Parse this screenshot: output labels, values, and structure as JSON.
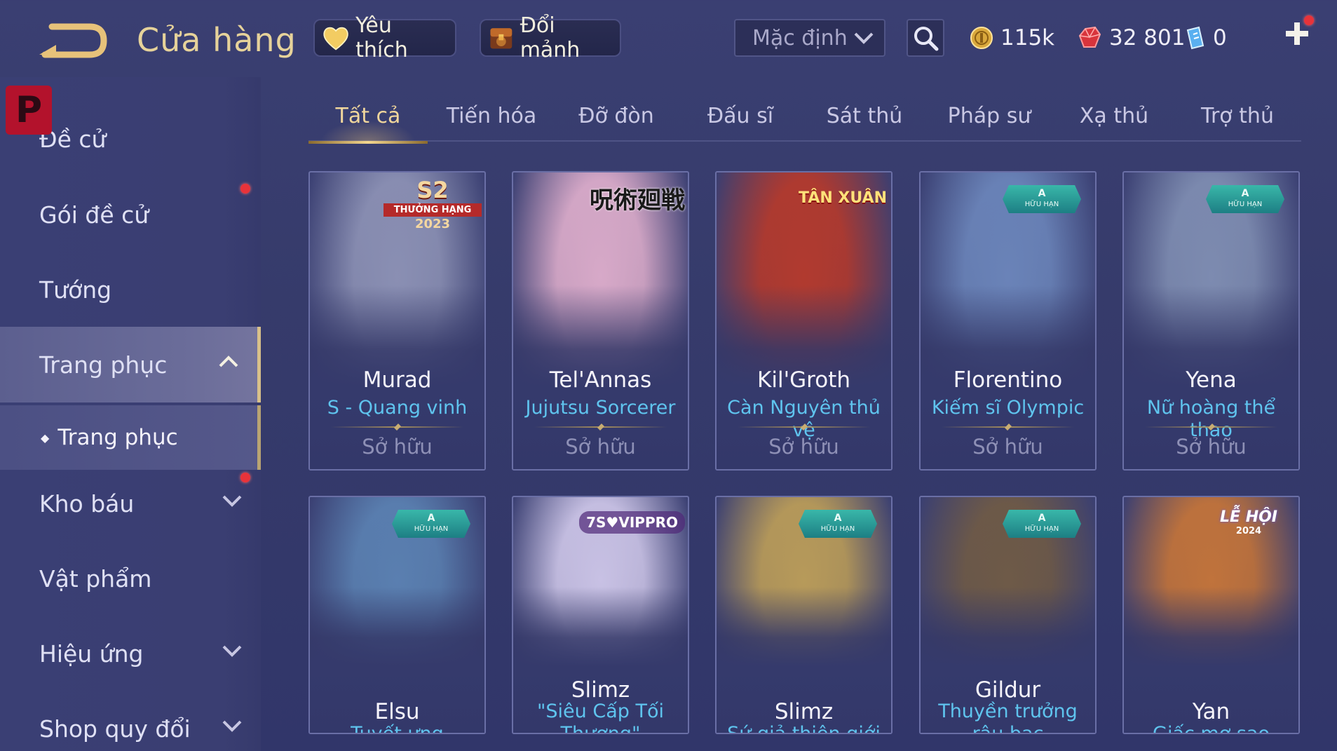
{
  "header": {
    "title": "Cửa hàng",
    "favorites_label": "Yêu thích",
    "shards_label": "Đổi mảnh",
    "sort_value": "Mặc định"
  },
  "currencies": {
    "gold": "115k",
    "gems": "32 801",
    "vouchers": "0"
  },
  "sidebar": {
    "logo_letter": "P",
    "items": [
      {
        "label": "Đề cử"
      },
      {
        "label": "Gói đề cử"
      },
      {
        "label": "Tướng"
      },
      {
        "label": "Trang phục"
      },
      {
        "label": "Kho báu"
      },
      {
        "label": "Vật phẩm"
      },
      {
        "label": "Hiệu ứng"
      },
      {
        "label": "Shop quy đổi"
      }
    ],
    "sub_item": "Trang phục"
  },
  "tabs": [
    {
      "label": "Tất cả"
    },
    {
      "label": "Tiến hóa"
    },
    {
      "label": "Đỡ đòn"
    },
    {
      "label": "Đấu sĩ"
    },
    {
      "label": "Sát thủ"
    },
    {
      "label": "Pháp sư"
    },
    {
      "label": "Xạ thủ"
    },
    {
      "label": "Trợ thủ"
    }
  ],
  "badges": {
    "limited_letter": "A",
    "limited_text": "HỮU HẠN",
    "s2_main": "S2",
    "s2_sub": "THƯỞNG HẠNG",
    "s2_year": "2023",
    "jujutsu": "呪術廻戦",
    "tanxuan": "TÂN XUÂN",
    "viippro": "7S♥VIPPRO",
    "lehoi": "LỄ HỘI",
    "lehoi_year": "2024"
  },
  "skins": [
    {
      "hero": "Murad",
      "skin": "S - Quang vinh",
      "status": "Sở hữu",
      "color": "#8a8fb3"
    },
    {
      "hero": "Tel'Annas",
      "skin": "Jujutsu Sorcerer",
      "status": "Sở hữu",
      "color": "#d7a9c8"
    },
    {
      "hero": "Kil'Groth",
      "skin": "Càn Nguyên thủ vệ",
      "status": "Sở hữu",
      "color": "#b13a2f"
    },
    {
      "hero": "Florentino",
      "skin": "Kiếm sĩ Olympic",
      "status": "Sở hữu",
      "color": "#6a83b8"
    },
    {
      "hero": "Yena",
      "skin": "Nữ hoàng thể thao",
      "status": "Sở hữu",
      "color": "#7d8bb0"
    },
    {
      "hero": "Elsu",
      "skin": "Tuyết ưng",
      "color": "#5a7fb0"
    },
    {
      "hero": "Slimz",
      "skin": "\"Siêu Cấp Tối Thượng\"",
      "color": "#c8c1e4"
    },
    {
      "hero": "Slimz",
      "skin": "Sứ giả thiên giới",
      "color": "#b79a5a"
    },
    {
      "hero": "Gildur",
      "skin": "Thuyền trưởng râu bạc",
      "color": "#6e5a48"
    },
    {
      "hero": "Yan",
      "skin": "Giấc mơ sao",
      "color": "#c0733c"
    }
  ]
}
